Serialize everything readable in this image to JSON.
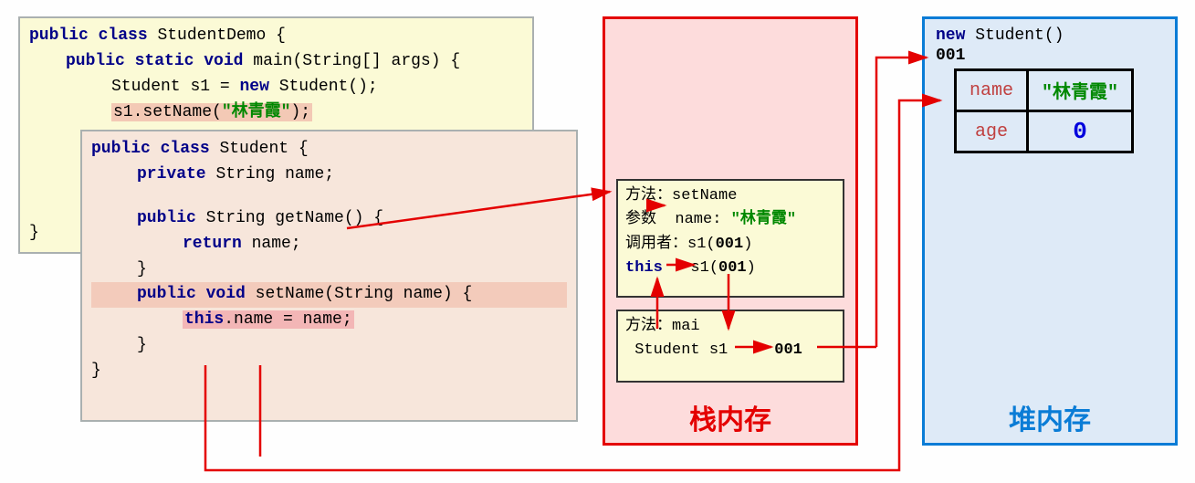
{
  "code1": {
    "line1": {
      "kw1": "public",
      "kw2": "class",
      "name": "StudentDemo",
      "brace": "{"
    },
    "line2": {
      "kw1": "public",
      "kw2": "static",
      "kw3": "void",
      "name": "main",
      "params": "(String[] args) {"
    },
    "line3": {
      "type": "Student",
      "var": "s1",
      "eq": "=",
      "kw": "new",
      "ctor": "Student();"
    },
    "line4": {
      "call": "s1.setName(",
      "arg": "\"林青霞\"",
      "end": ");"
    },
    "close": "}"
  },
  "code2": {
    "line1": {
      "kw1": "public",
      "kw2": "class",
      "name": "Student",
      "brace": "{"
    },
    "line2": {
      "kw": "private",
      "type": "String",
      "name": "name;"
    },
    "line3": {
      "kw": "public",
      "type": "String",
      "name": "getName() {"
    },
    "line4": {
      "kw": "return",
      "expr": "name;"
    },
    "brace_close": "}",
    "line5": {
      "kw1": "public",
      "kw2": "void",
      "name": "setName(String name) {"
    },
    "line6": {
      "this": "this",
      "rest": ".name = name;"
    },
    "brace_close2": "}",
    "brace_close3": "}"
  },
  "stack": {
    "label": "栈内存",
    "frame_setname": {
      "l1a": "方法：",
      "l1b": "setName",
      "l2a": "参数",
      "l2b": "name: ",
      "l2c": "\"林青霞\"",
      "l3a": "调用者：",
      "l3b": "s1(",
      "l3c": "001",
      "l3d": ")",
      "l4a": "this",
      "l4b": "s1(",
      "l4c": "001",
      "l4d": ")"
    },
    "frame_main": {
      "l1a": "方法：",
      "l1b": "mai",
      "l2a": "Student s1",
      "l2c": "001"
    }
  },
  "heap": {
    "label": "堆内存",
    "kw": "new",
    "ctor": "Student()",
    "addr": "001",
    "row1_name": "name",
    "row1_val": "\"林青霞\"",
    "row2_name": "age",
    "row2_val": "0"
  }
}
